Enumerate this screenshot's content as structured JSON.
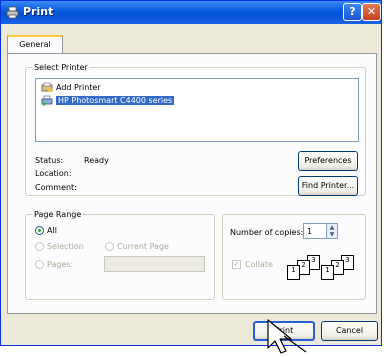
{
  "window": {
    "title": "Print"
  },
  "tabs": [
    {
      "label": "General"
    }
  ],
  "select_printer": {
    "group_label": "Select Printer",
    "printers": [
      {
        "label": "Add Printer",
        "icon": "add-printer-icon",
        "selected": false
      },
      {
        "label": "HP Photosmart C4400 series",
        "icon": "printer-icon",
        "selected": true
      }
    ],
    "status_label": "Status:",
    "status_value": "Ready",
    "location_label": "Location:",
    "comment_label": "Comment:",
    "preferences_button": "Preferences",
    "find_printer_button": "Find Printer..."
  },
  "page_range": {
    "group_label": "Page Range",
    "all_label": "All",
    "selection_label": "Selection",
    "current_page_label": "Current Page",
    "pages_label": "Pages:",
    "pages_value": ""
  },
  "copies": {
    "number_label": "Number of copies:",
    "number_value": "1",
    "collate_label": "Collate",
    "collate_checked": true
  },
  "buttons": {
    "print": "Print",
    "cancel": "Cancel"
  },
  "colors": {
    "titlebar": "#0b5ee0",
    "selection": "#316ac5",
    "accent_tab": "#ffc83c"
  }
}
